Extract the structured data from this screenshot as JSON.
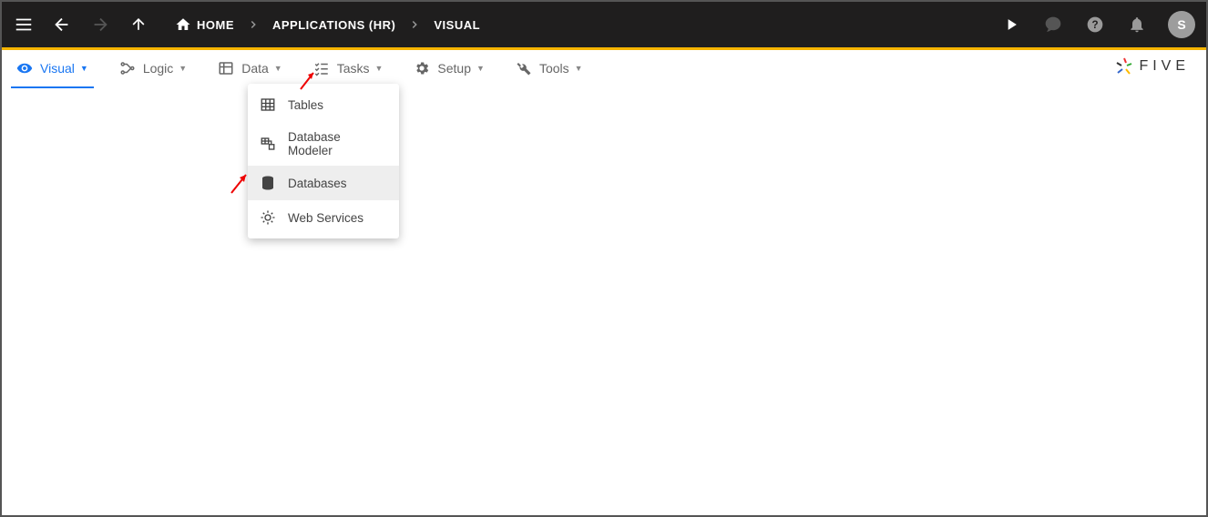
{
  "topbar": {
    "breadcrumb": {
      "home": "HOME",
      "app": "APPLICATIONS (HR)",
      "page": "VISUAL"
    },
    "avatar_initial": "S"
  },
  "tabs": {
    "visual": "Visual",
    "logic": "Logic",
    "data": "Data",
    "tasks": "Tasks",
    "setup": "Setup",
    "tools": "Tools"
  },
  "data_dropdown": {
    "tables": "Tables",
    "modeler": "Database Modeler",
    "databases": "Databases",
    "webservices": "Web Services"
  },
  "brand": "FIVE"
}
